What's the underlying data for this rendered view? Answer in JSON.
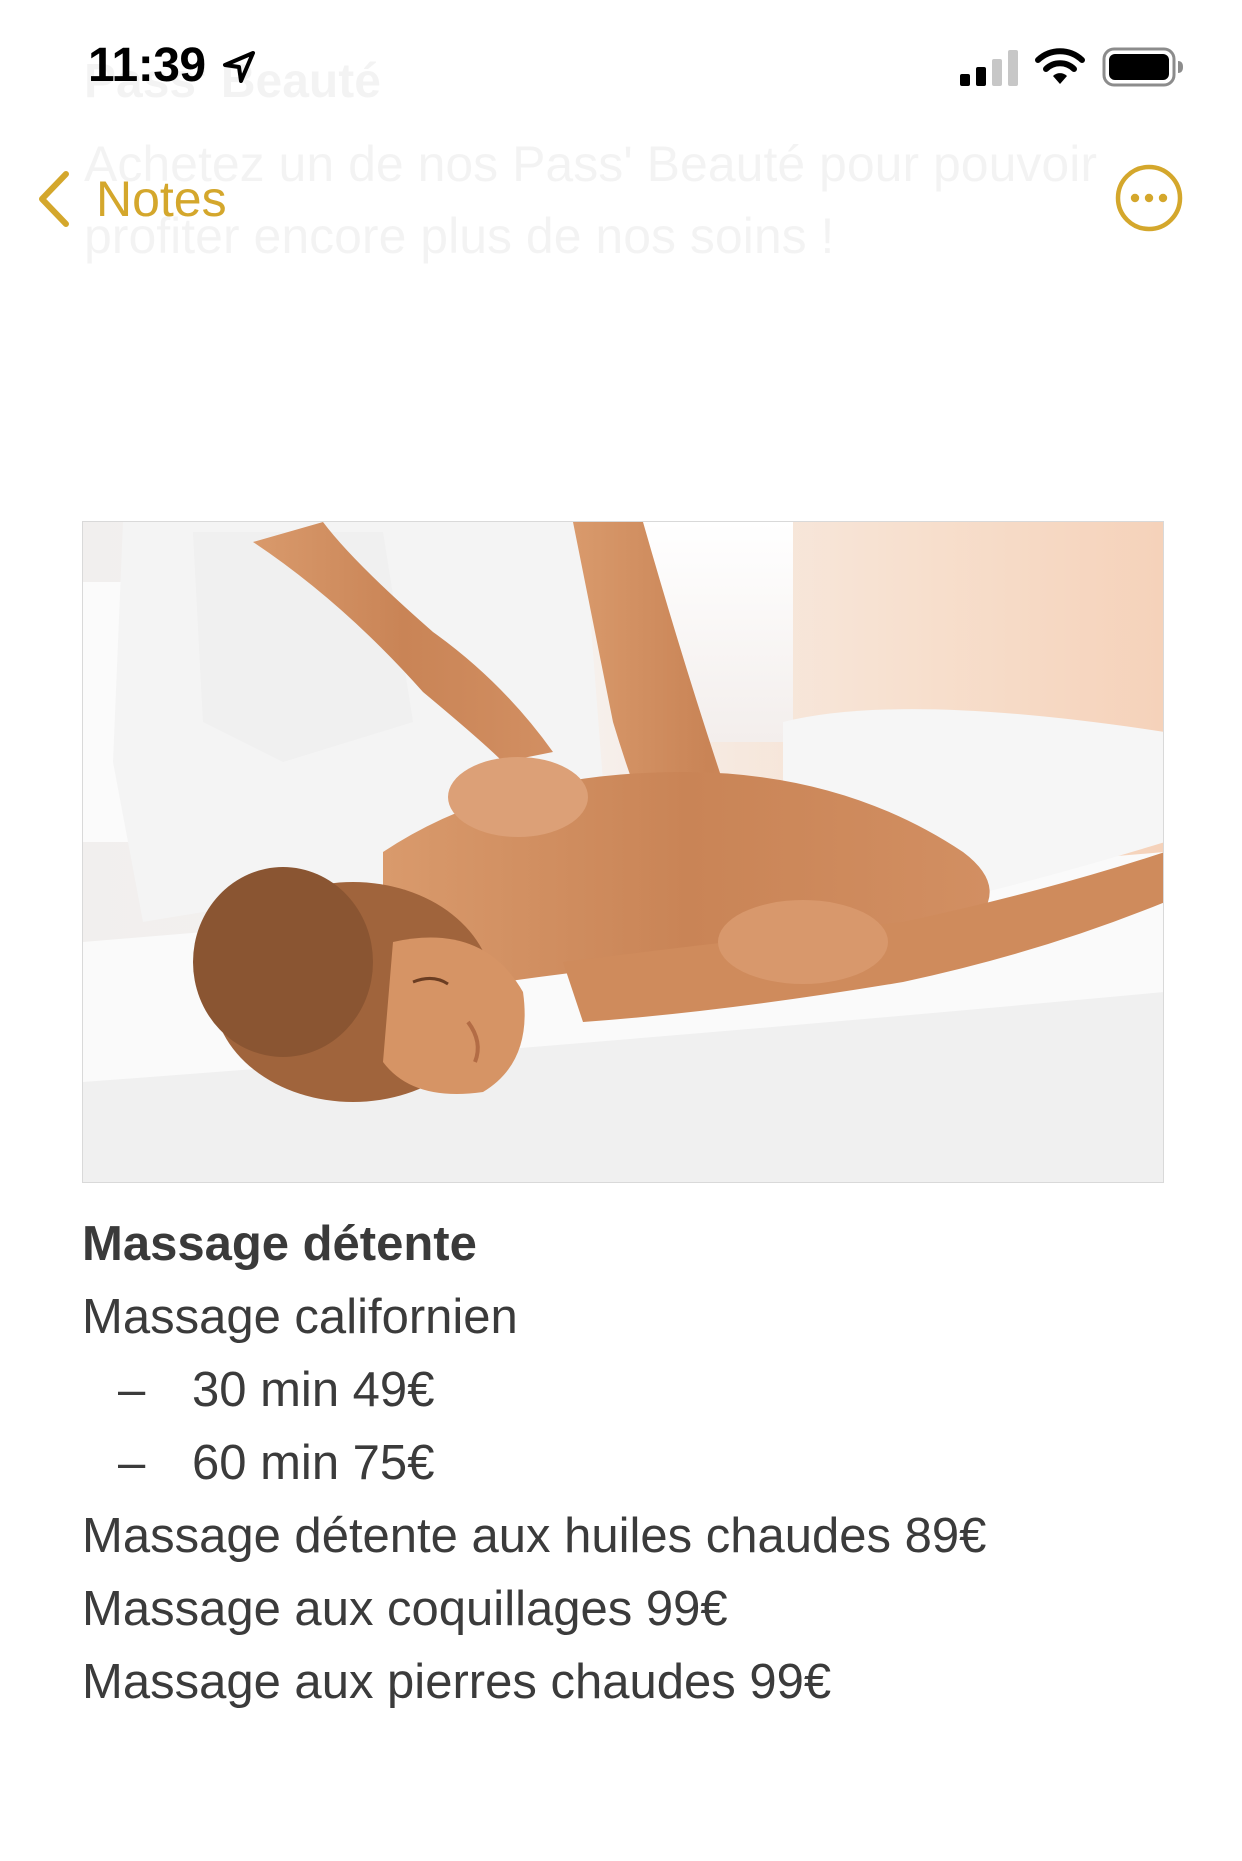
{
  "status_bar": {
    "time": "11:39",
    "icons": [
      "location-arrow-icon",
      "cellular-signal-icon",
      "wifi-icon",
      "battery-icon"
    ]
  },
  "nav": {
    "back_label": "Notes",
    "back_icon": "chevron-left-icon",
    "more_icon": "ellipsis-circle-icon",
    "accent_color": "#D4A72C"
  },
  "ghost": {
    "title": "Pass' Beauté",
    "text": "Achetez un de nos Pass' Beauté pour pouvoir profiter encore plus de nos soins !"
  },
  "note": {
    "heading": "Massage détente",
    "subheading": "Massage californien",
    "options": [
      "30 min 49€",
      "60 min 75€"
    ],
    "bullet": "–",
    "lines": [
      "Massage détente aux huiles chaudes 89€",
      "Massage aux coquillages 99€",
      "Massage aux pierres chaudes 99€"
    ]
  }
}
